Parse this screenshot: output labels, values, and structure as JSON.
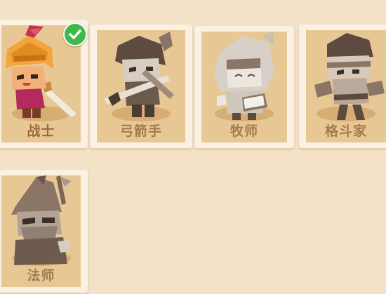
{
  "heroes": [
    {
      "name": "战士",
      "selected": true,
      "unlocked": true,
      "icon": "warrior-knight-helmet-icon"
    },
    {
      "name": "弓箭手",
      "selected": false,
      "unlocked": false,
      "icon": "archer-crossbow-icon"
    },
    {
      "name": "牧师",
      "selected": false,
      "unlocked": false,
      "icon": "priest-hooded-book-icon"
    },
    {
      "name": "格斗家",
      "selected": false,
      "unlocked": false,
      "icon": "fighter-boxer-icon"
    },
    {
      "name": "法师",
      "selected": false,
      "unlocked": false,
      "icon": "mage-wizard-hat-icon"
    }
  ],
  "colors": {
    "background": "#f3e2c8",
    "card_frame": "#fbf1e2",
    "card_panel": "#e7c895",
    "name_text": "#a0683a",
    "selected_check": "#3fb94a"
  }
}
